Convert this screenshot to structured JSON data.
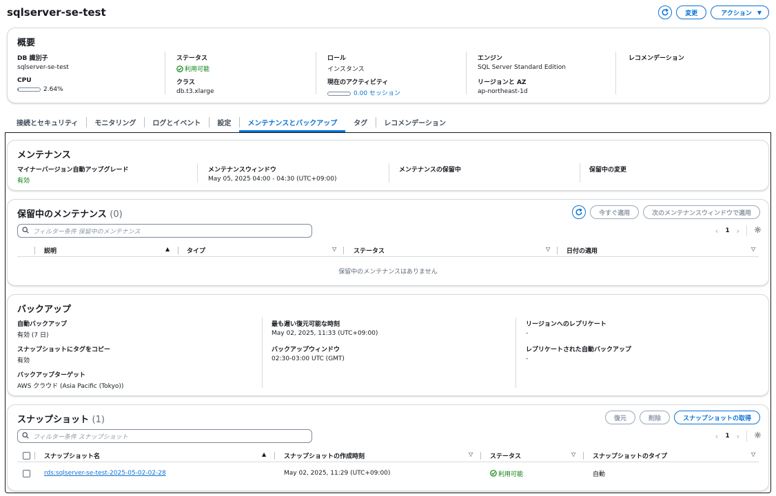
{
  "page_title": "sqlserver-se-test",
  "header": {
    "modify_label": "変更",
    "actions_label": "アクション"
  },
  "summary": {
    "title": "概要",
    "db_id_label": "DB 識別子",
    "db_id": "sqlserver-se-test",
    "cpu_label": "CPU",
    "cpu_value": "2.64%",
    "cpu_percent": 2.64,
    "status_label": "ステータス",
    "status_value": "利用可能",
    "class_label": "クラス",
    "class_value": "db.t3.xlarge",
    "role_label": "ロール",
    "role_value": "インスタンス",
    "activity_label": "現在のアクティビティ",
    "activity_value": "0.00 セッション",
    "activity_level": 0,
    "engine_label": "エンジン",
    "engine_value": "SQL Server Standard Edition",
    "region_label": "リージョンと AZ",
    "region_value": "ap-northeast-1d",
    "recommendation_label": "レコメンデーション"
  },
  "tabs": [
    {
      "label": "接続とセキュリティ"
    },
    {
      "label": "モニタリング"
    },
    {
      "label": "ログとイベント"
    },
    {
      "label": "設定"
    },
    {
      "label": "メンテナンスとバックアップ",
      "active": true
    },
    {
      "label": "タグ"
    },
    {
      "label": "レコメンデーション"
    }
  ],
  "maintenance": {
    "title": "メンテナンス",
    "minor_upgrade_label": "マイナーバージョン自動アップグレード",
    "minor_upgrade_value": "有効",
    "window_label": "メンテナンスウィンドウ",
    "window_value": "May 05, 2025 04:00 - 04:30 (UTC+09:00)",
    "pending_label": "メンテナンスの保留中",
    "pending_changes_label": "保留中の変更"
  },
  "pending": {
    "title": "保留中のメンテナンス",
    "count": "(0)",
    "apply_now_label": "今すぐ適用",
    "apply_next_label": "次のメンテナンスウィンドウで適用",
    "search_placeholder": "フィルター条件 保留中のメンテナンス",
    "page": "1",
    "columns": [
      "説明",
      "タイプ",
      "ステータス",
      "日付の適用"
    ],
    "empty_text": "保留中のメンテナンスはありません"
  },
  "backup": {
    "title": "バックアップ",
    "auto_label": "自動バックアップ",
    "auto_value": "有効 (7 日)",
    "copy_tags_label": "スナップショットにタグをコピー",
    "copy_tags_value": "有効",
    "target_label": "バックアップターゲット",
    "target_value": "AWS クラウド (Asia Pacific (Tokyo))",
    "latest_restore_label": "最も遅い復元可能な時刻",
    "latest_restore_value": "May 02, 2025, 11:33 (UTC+09:00)",
    "window_label": "バックアップウィンドウ",
    "window_value": "02:30-03:00 UTC (GMT)",
    "region_repl_label": "リージョンへのレプリケート",
    "region_repl_value": "-",
    "repl_auto_label": "レプリケートされた自動バックアップ",
    "repl_auto_value": "-"
  },
  "snapshots": {
    "title": "スナップショット",
    "count": "(1)",
    "restore_label": "復元",
    "delete_label": "削除",
    "take_label": "スナップショットの取得",
    "search_placeholder": "フィルター条件 スナップショット",
    "page": "1",
    "columns": [
      "スナップショット名",
      "スナップショットの作成時刻",
      "ステータス",
      "スナップショットのタイプ"
    ],
    "rows": [
      {
        "name": "rds:sqlserver-se-test-2025-05-02-02-28",
        "created": "May 02, 2025, 11:29 (UTC+09:00)",
        "status": "利用可能",
        "type": "自動"
      }
    ]
  },
  "colors": {
    "accent": "#0972d3",
    "success": "#037f0c",
    "border": "#d5dbdb"
  }
}
